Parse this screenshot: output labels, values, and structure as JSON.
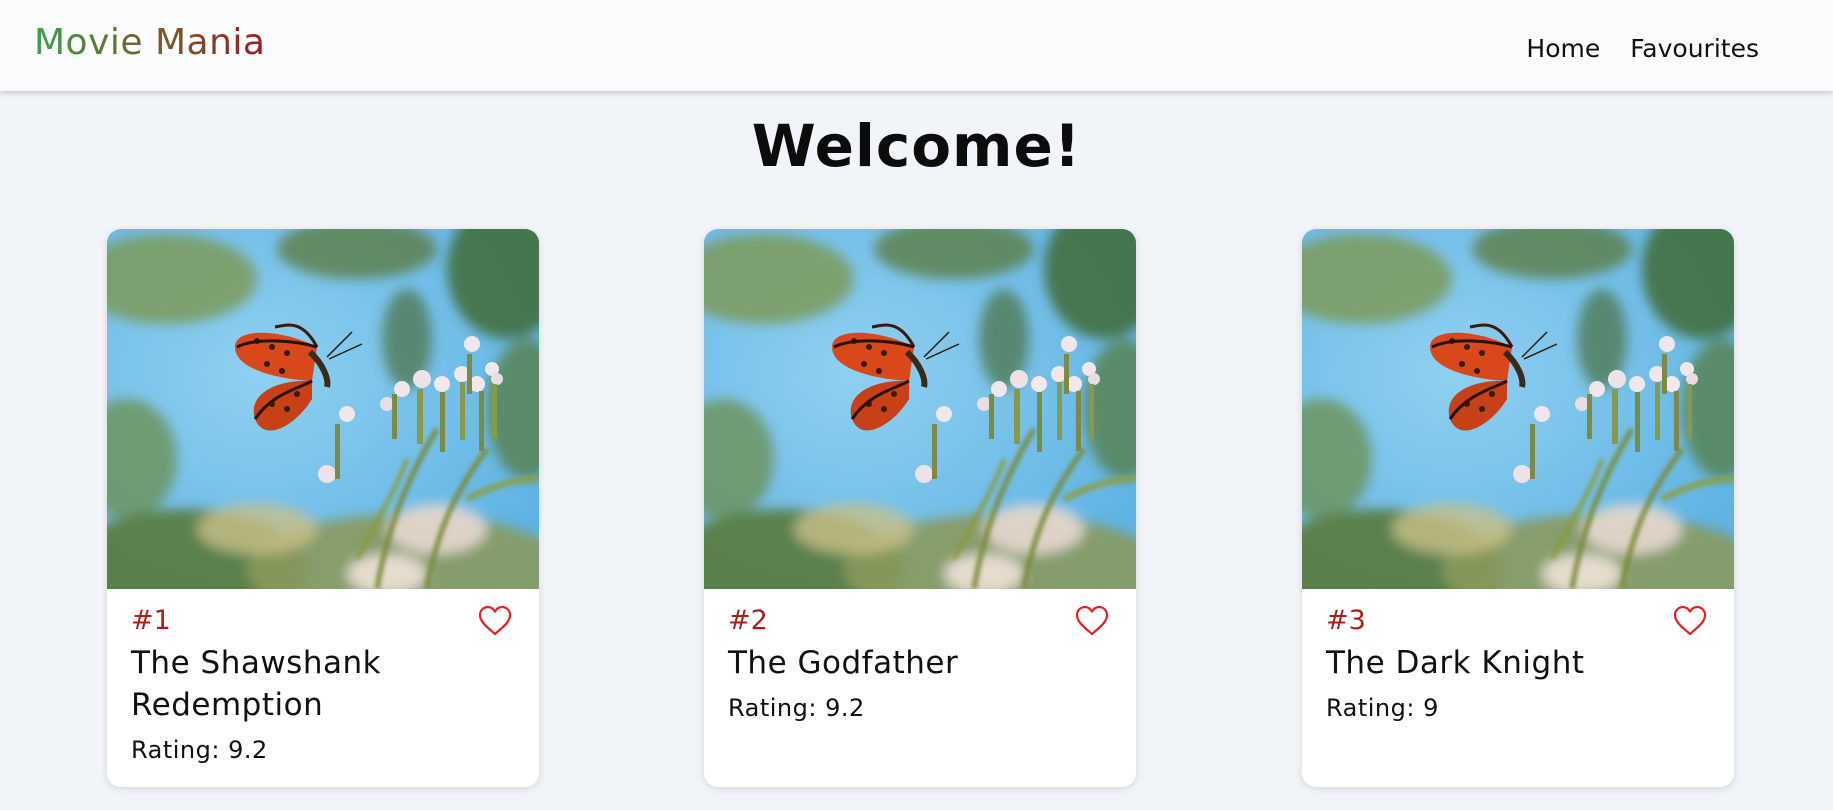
{
  "app": {
    "brand": "Movie Mania"
  },
  "nav": {
    "home": "Home",
    "favourites": "Favourites"
  },
  "page": {
    "heading": "Welcome!"
  },
  "movies": [
    {
      "rank": "#1",
      "title": "The Shawshank Redemption",
      "rating": "Rating: 9.2",
      "poster_icon": "butterfly-photo",
      "favourite_icon": "heart-outline-icon"
    },
    {
      "rank": "#2",
      "title": "The Godfather",
      "rating": "Rating: 9.2",
      "poster_icon": "butterfly-photo",
      "favourite_icon": "heart-outline-icon"
    },
    {
      "rank": "#3",
      "title": "The Dark Knight",
      "rating": "Rating: 9",
      "poster_icon": "butterfly-photo",
      "favourite_icon": "heart-outline-icon"
    }
  ],
  "colors": {
    "background": "#f1f4f8",
    "rank": "#a8201e",
    "heart": "#e32222",
    "brand_start": "#3aa14a",
    "brand_end": "#9c1d1d"
  }
}
